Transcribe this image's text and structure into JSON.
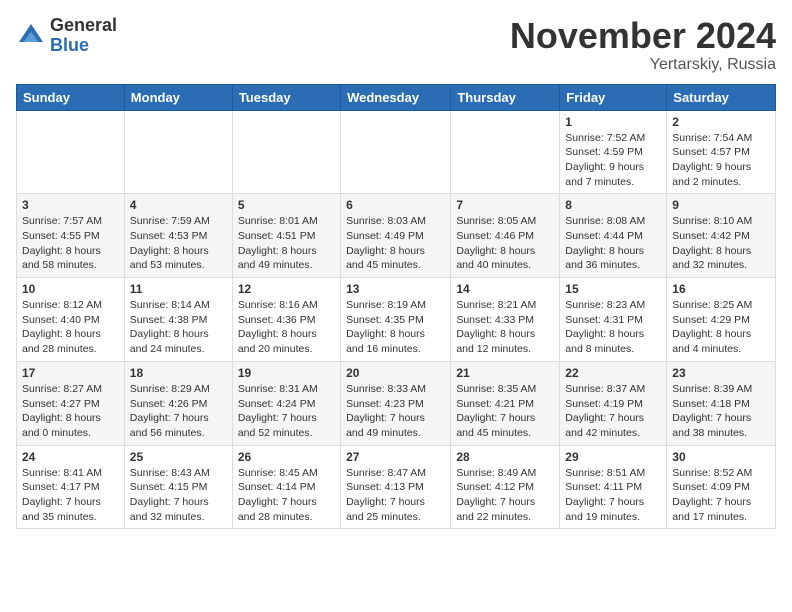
{
  "logo": {
    "general": "General",
    "blue": "Blue"
  },
  "header": {
    "month": "November 2024",
    "location": "Yertarskiy, Russia"
  },
  "weekdays": [
    "Sunday",
    "Monday",
    "Tuesday",
    "Wednesday",
    "Thursday",
    "Friday",
    "Saturday"
  ],
  "weeks": [
    [
      {
        "day": "",
        "info": ""
      },
      {
        "day": "",
        "info": ""
      },
      {
        "day": "",
        "info": ""
      },
      {
        "day": "",
        "info": ""
      },
      {
        "day": "",
        "info": ""
      },
      {
        "day": "1",
        "info": "Sunrise: 7:52 AM\nSunset: 4:59 PM\nDaylight: 9 hours\nand 7 minutes."
      },
      {
        "day": "2",
        "info": "Sunrise: 7:54 AM\nSunset: 4:57 PM\nDaylight: 9 hours\nand 2 minutes."
      }
    ],
    [
      {
        "day": "3",
        "info": "Sunrise: 7:57 AM\nSunset: 4:55 PM\nDaylight: 8 hours\nand 58 minutes."
      },
      {
        "day": "4",
        "info": "Sunrise: 7:59 AM\nSunset: 4:53 PM\nDaylight: 8 hours\nand 53 minutes."
      },
      {
        "day": "5",
        "info": "Sunrise: 8:01 AM\nSunset: 4:51 PM\nDaylight: 8 hours\nand 49 minutes."
      },
      {
        "day": "6",
        "info": "Sunrise: 8:03 AM\nSunset: 4:49 PM\nDaylight: 8 hours\nand 45 minutes."
      },
      {
        "day": "7",
        "info": "Sunrise: 8:05 AM\nSunset: 4:46 PM\nDaylight: 8 hours\nand 40 minutes."
      },
      {
        "day": "8",
        "info": "Sunrise: 8:08 AM\nSunset: 4:44 PM\nDaylight: 8 hours\nand 36 minutes."
      },
      {
        "day": "9",
        "info": "Sunrise: 8:10 AM\nSunset: 4:42 PM\nDaylight: 8 hours\nand 32 minutes."
      }
    ],
    [
      {
        "day": "10",
        "info": "Sunrise: 8:12 AM\nSunset: 4:40 PM\nDaylight: 8 hours\nand 28 minutes."
      },
      {
        "day": "11",
        "info": "Sunrise: 8:14 AM\nSunset: 4:38 PM\nDaylight: 8 hours\nand 24 minutes."
      },
      {
        "day": "12",
        "info": "Sunrise: 8:16 AM\nSunset: 4:36 PM\nDaylight: 8 hours\nand 20 minutes."
      },
      {
        "day": "13",
        "info": "Sunrise: 8:19 AM\nSunset: 4:35 PM\nDaylight: 8 hours\nand 16 minutes."
      },
      {
        "day": "14",
        "info": "Sunrise: 8:21 AM\nSunset: 4:33 PM\nDaylight: 8 hours\nand 12 minutes."
      },
      {
        "day": "15",
        "info": "Sunrise: 8:23 AM\nSunset: 4:31 PM\nDaylight: 8 hours\nand 8 minutes."
      },
      {
        "day": "16",
        "info": "Sunrise: 8:25 AM\nSunset: 4:29 PM\nDaylight: 8 hours\nand 4 minutes."
      }
    ],
    [
      {
        "day": "17",
        "info": "Sunrise: 8:27 AM\nSunset: 4:27 PM\nDaylight: 8 hours\nand 0 minutes."
      },
      {
        "day": "18",
        "info": "Sunrise: 8:29 AM\nSunset: 4:26 PM\nDaylight: 7 hours\nand 56 minutes."
      },
      {
        "day": "19",
        "info": "Sunrise: 8:31 AM\nSunset: 4:24 PM\nDaylight: 7 hours\nand 52 minutes."
      },
      {
        "day": "20",
        "info": "Sunrise: 8:33 AM\nSunset: 4:23 PM\nDaylight: 7 hours\nand 49 minutes."
      },
      {
        "day": "21",
        "info": "Sunrise: 8:35 AM\nSunset: 4:21 PM\nDaylight: 7 hours\nand 45 minutes."
      },
      {
        "day": "22",
        "info": "Sunrise: 8:37 AM\nSunset: 4:19 PM\nDaylight: 7 hours\nand 42 minutes."
      },
      {
        "day": "23",
        "info": "Sunrise: 8:39 AM\nSunset: 4:18 PM\nDaylight: 7 hours\nand 38 minutes."
      }
    ],
    [
      {
        "day": "24",
        "info": "Sunrise: 8:41 AM\nSunset: 4:17 PM\nDaylight: 7 hours\nand 35 minutes."
      },
      {
        "day": "25",
        "info": "Sunrise: 8:43 AM\nSunset: 4:15 PM\nDaylight: 7 hours\nand 32 minutes."
      },
      {
        "day": "26",
        "info": "Sunrise: 8:45 AM\nSunset: 4:14 PM\nDaylight: 7 hours\nand 28 minutes."
      },
      {
        "day": "27",
        "info": "Sunrise: 8:47 AM\nSunset: 4:13 PM\nDaylight: 7 hours\nand 25 minutes."
      },
      {
        "day": "28",
        "info": "Sunrise: 8:49 AM\nSunset: 4:12 PM\nDaylight: 7 hours\nand 22 minutes."
      },
      {
        "day": "29",
        "info": "Sunrise: 8:51 AM\nSunset: 4:11 PM\nDaylight: 7 hours\nand 19 minutes."
      },
      {
        "day": "30",
        "info": "Sunrise: 8:52 AM\nSunset: 4:09 PM\nDaylight: 7 hours\nand 17 minutes."
      }
    ]
  ]
}
